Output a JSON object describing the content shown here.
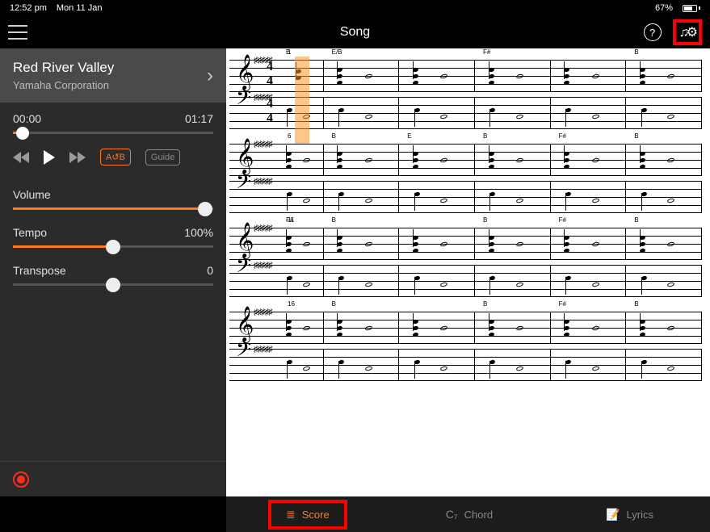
{
  "status": {
    "time": "12:52 pm",
    "date": "Mon 11 Jan",
    "battery_pct": "67%"
  },
  "header": {
    "title": "Song"
  },
  "song": {
    "title": "Red River Valley",
    "artist": "Yamaha Corporation",
    "elapsed": "00:00",
    "duration": "01:17",
    "progress_pct": 5
  },
  "transport": {
    "ab_label": "A↺B",
    "guide_label": "Guide"
  },
  "controls": {
    "volume": {
      "label": "Volume",
      "value": "",
      "pct": 96
    },
    "tempo": {
      "label": "Tempo",
      "value": "100%",
      "pct": 50
    },
    "transpose": {
      "label": "Transpose",
      "value": "0",
      "pct": 50
    }
  },
  "score": {
    "systems": [
      {
        "measure_start": 1,
        "chords": [
          "B",
          "E/B",
          "",
          "F#",
          "",
          "B"
        ]
      },
      {
        "measure_start": 6,
        "chords": [
          "",
          "B",
          "E",
          "B",
          "F#",
          "B"
        ]
      },
      {
        "measure_start": 11,
        "chords": [
          "F#",
          "B",
          "",
          "B",
          "F#",
          "B"
        ]
      },
      {
        "measure_start": 16,
        "chords": [
          "",
          "B",
          "",
          "B",
          "F#",
          "B"
        ]
      }
    ],
    "time_sig_top": "4",
    "time_sig_bot": "4",
    "key_sharps": 5
  },
  "tabs": {
    "score": "Score",
    "chord": "Chord",
    "lyrics": "Lyrics",
    "chord_prefix": "C₇"
  }
}
